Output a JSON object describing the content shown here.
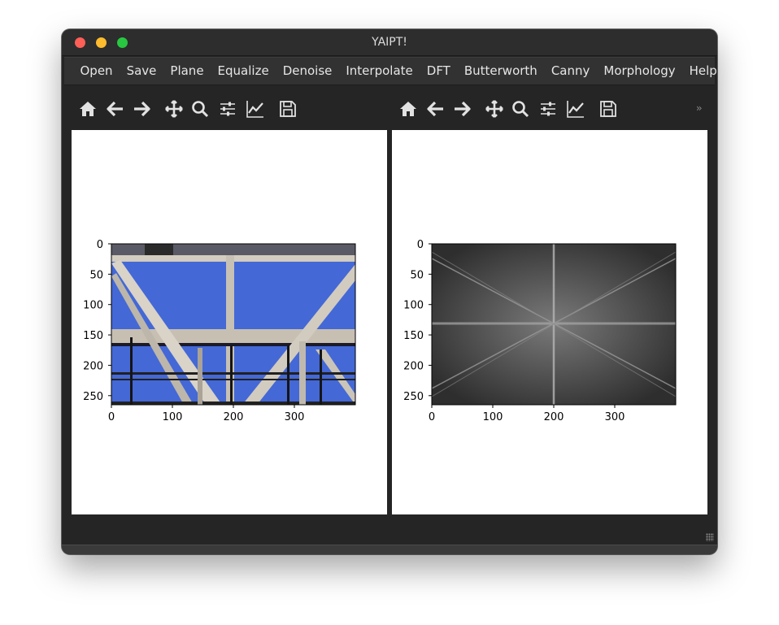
{
  "window": {
    "title": "YAIPT!"
  },
  "menu": [
    "Open",
    "Save",
    "Plane",
    "Equalize",
    "Denoise",
    "Interpolate",
    "DFT",
    "Butterworth",
    "Canny",
    "Morphology",
    "Help"
  ],
  "toolbar": {
    "icons": [
      "home-icon",
      "back-arrow-icon",
      "forward-arrow-icon",
      "pan-icon",
      "zoom-icon",
      "subplots-config-icon",
      "axes-edit-icon",
      "save-figure-icon"
    ],
    "overflow": "››"
  },
  "plots": {
    "left": {
      "name": "original-image",
      "x_ticks": [
        "0",
        "100",
        "200",
        "300"
      ],
      "y_ticks": [
        "0",
        "50",
        "100",
        "150",
        "200",
        "250"
      ]
    },
    "right": {
      "name": "dft-spectrum",
      "x_ticks": [
        "0",
        "100",
        "200",
        "300"
      ],
      "y_ticks": [
        "0",
        "50",
        "100",
        "150",
        "200",
        "250"
      ]
    }
  },
  "colors": {
    "sky": "#4468d6",
    "steel": "#c9c2b6",
    "spectrum_bg": "#3a3a3a"
  }
}
